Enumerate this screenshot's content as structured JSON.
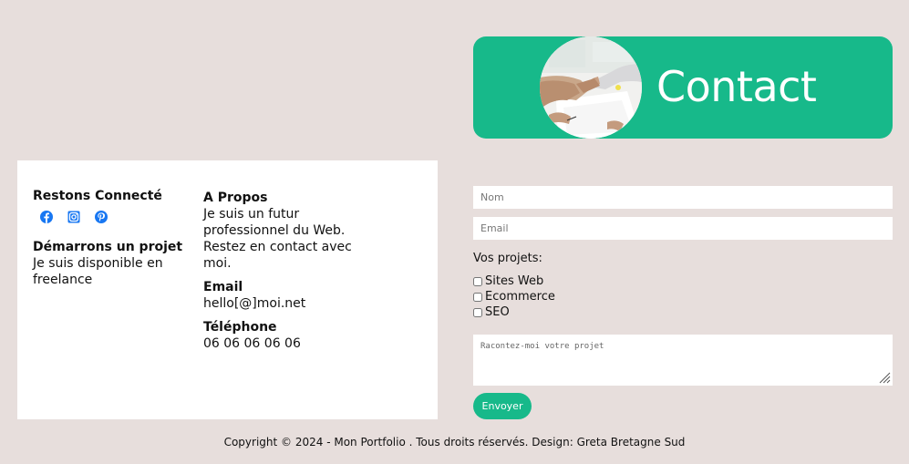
{
  "banner": {
    "title": "Contact"
  },
  "info": {
    "connect_heading": "Restons Connecté",
    "socials": [
      {
        "icon": "facebook-icon",
        "color": "#1877f2"
      },
      {
        "icon": "instagram-icon",
        "color": "#1877f2"
      },
      {
        "icon": "pinterest-icon",
        "color": "#1877f2"
      }
    ],
    "project_heading": "Démarrons un projet",
    "project_text": "Je suis disponible en freelance",
    "about_heading": "A Propos",
    "about_text": "Je suis un futur professionnel du Web. Restez en contact avec moi.",
    "email_heading": "Email",
    "email_value": "hello[@]moi.net",
    "phone_heading": "Téléphone",
    "phone_value": "06 06 06 06 06"
  },
  "form": {
    "name_placeholder": "Nom",
    "email_placeholder": "Email",
    "projects_label": "Vos projets:",
    "options": [
      "Sites Web",
      "Ecommerce",
      "SEO"
    ],
    "message_placeholder": "Racontez-moi votre projet",
    "submit_label": "Envoyer"
  },
  "footer": {
    "copyright": "Copyright © 2024 - Mon Portfolio . Tous droits réservés. Design: Greta Bretagne Sud"
  },
  "colors": {
    "page_background": "#e7dedc",
    "accent": "#17b98a",
    "card": "#ffffff",
    "social_icons": "#1877f2"
  }
}
